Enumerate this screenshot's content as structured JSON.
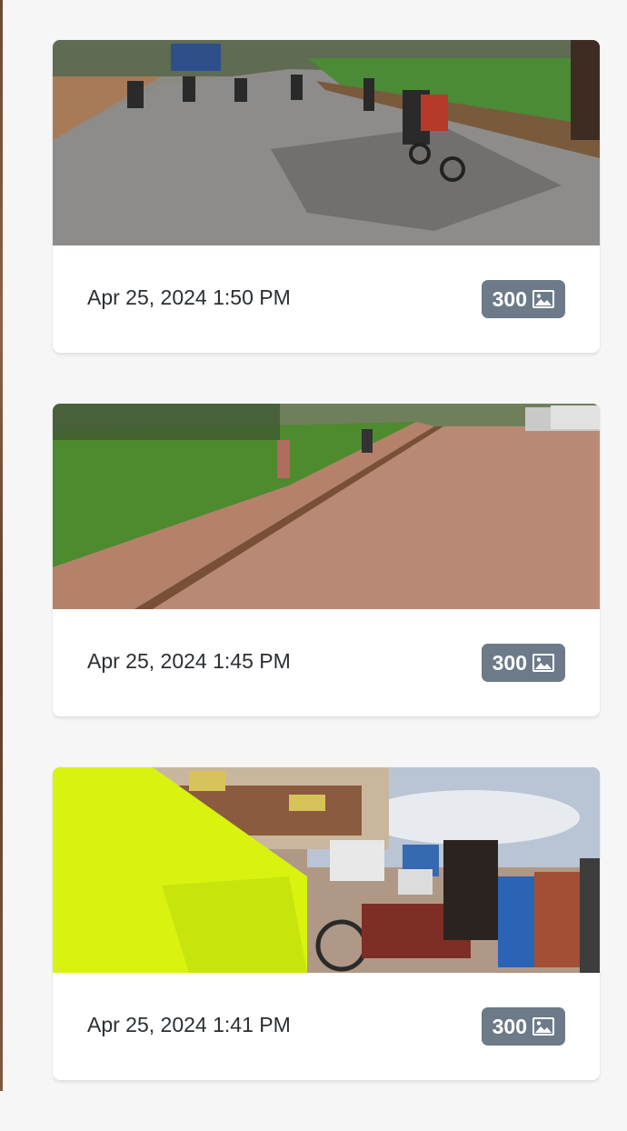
{
  "feed": {
    "items": [
      {
        "timestamp": "Apr 25, 2024 1:50 PM",
        "count": "300",
        "icon": "image-icon"
      },
      {
        "timestamp": "Apr 25, 2024 1:45 PM",
        "count": "300",
        "icon": "image-icon"
      },
      {
        "timestamp": "Apr 25, 2024 1:41 PM",
        "count": "300",
        "icon": "image-icon"
      }
    ]
  },
  "colors": {
    "background": "#f6f6f7",
    "card": "#ffffff",
    "badge": "#6c7a89",
    "text": "#2b2f33"
  }
}
